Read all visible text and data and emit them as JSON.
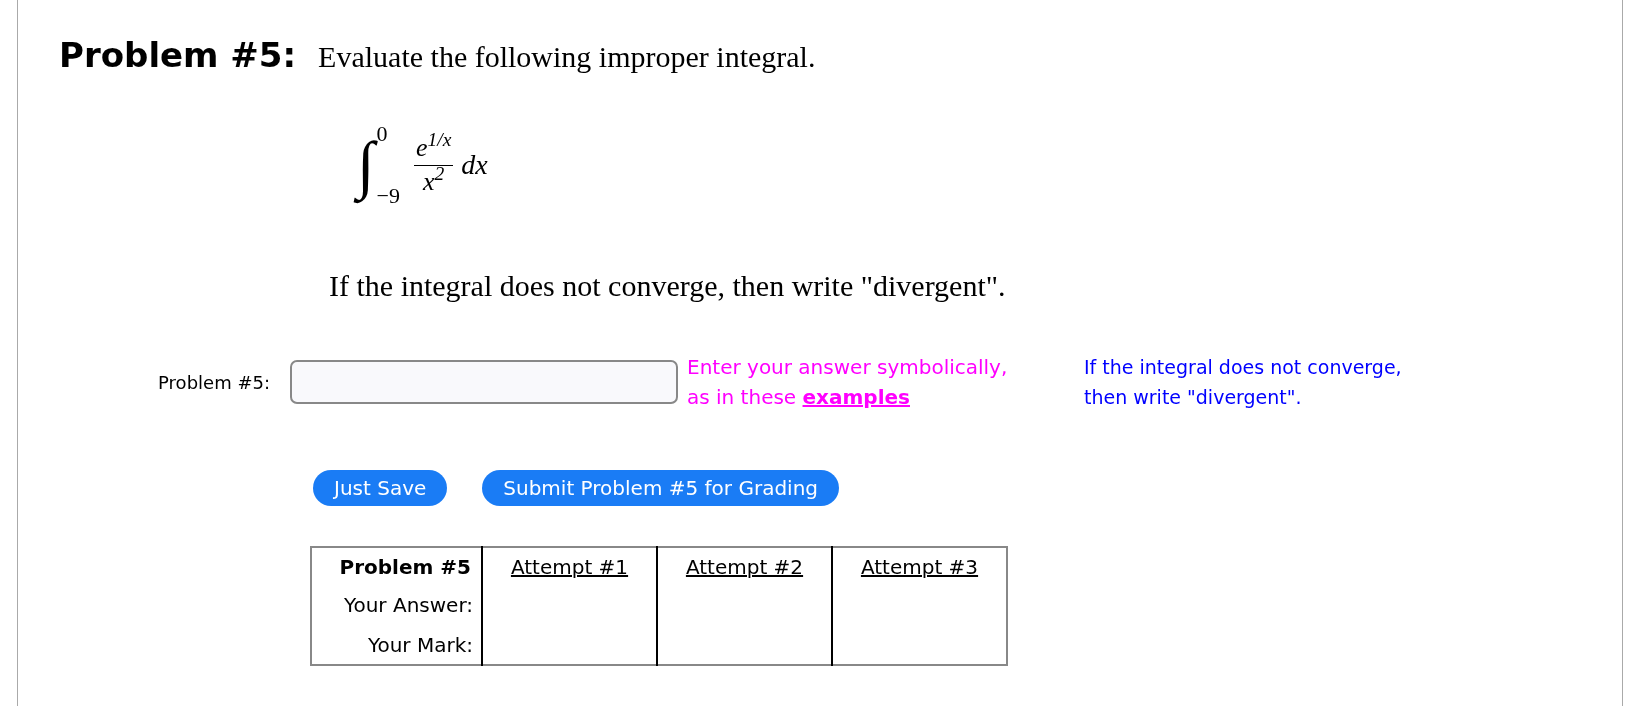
{
  "problem": {
    "heading": "Problem #5:",
    "prompt": "Evaluate the following improper integral.",
    "integral": {
      "sign": "∫",
      "upper": "0",
      "lower": "−9",
      "numerator": "e$^{1/x}$",
      "denominator": "x$^{2}$",
      "differential": "dx"
    },
    "note": "If the integral does not converge, then write \"divergent\"."
  },
  "answer": {
    "label": "Problem #5:",
    "hint": "Enter your answer symbolically, as in these",
    "hint_link": "examples",
    "side_note": "If the integral does not converge, then write \"divergent\"."
  },
  "buttons": [
    {
      "label": "Just Save"
    },
    {
      "label": "Submit Problem #5 for Grading"
    }
  ],
  "table": {
    "columns": [
      "Problem #5",
      "Attempt #1",
      "Attempt #2",
      "Attempt #3"
    ],
    "rows": [
      {
        "label": "Your Answer:",
        "cells": [
          "",
          "",
          ""
        ]
      },
      {
        "label": "Your Mark:",
        "cells": [
          "",
          "",
          ""
        ]
      }
    ]
  }
}
